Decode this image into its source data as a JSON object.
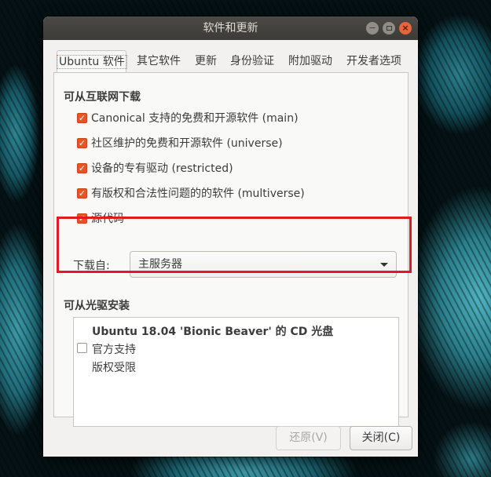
{
  "window": {
    "title": "软件和更新"
  },
  "tabs": [
    {
      "label": "Ubuntu 软件",
      "active": true
    },
    {
      "label": "其它软件",
      "active": false
    },
    {
      "label": "更新",
      "active": false
    },
    {
      "label": "身份验证",
      "active": false
    },
    {
      "label": "附加驱动",
      "active": false
    },
    {
      "label": "开发者选项",
      "active": false
    }
  ],
  "internet": {
    "heading": "可从互联网下载",
    "items": [
      {
        "label": "Canonical 支持的免费和开源软件 (main)",
        "checked": true
      },
      {
        "label": "社区维护的免费和开源软件 (universe)",
        "checked": true
      },
      {
        "label": "设备的专有驱动 (restricted)",
        "checked": true
      },
      {
        "label": "有版权和合法性问题的的软件 (multiverse)",
        "checked": true
      },
      {
        "label": "源代码",
        "checked": true
      }
    ],
    "download_from_label": "下载自:",
    "download_from_value": "主服务器"
  },
  "cdrom": {
    "heading": "可从光驱安装",
    "entry": {
      "title": "Ubuntu 18.04 'Bionic Beaver' 的 CD 光盘",
      "line2": "官方支持",
      "line3": "版权受限",
      "checked": false
    }
  },
  "buttons": {
    "revert": "还原(V)",
    "close": "关闭(C)"
  },
  "colors": {
    "accent": "#e95420",
    "highlight_box": "#e01a22",
    "titlebar": "#3c3b37"
  }
}
